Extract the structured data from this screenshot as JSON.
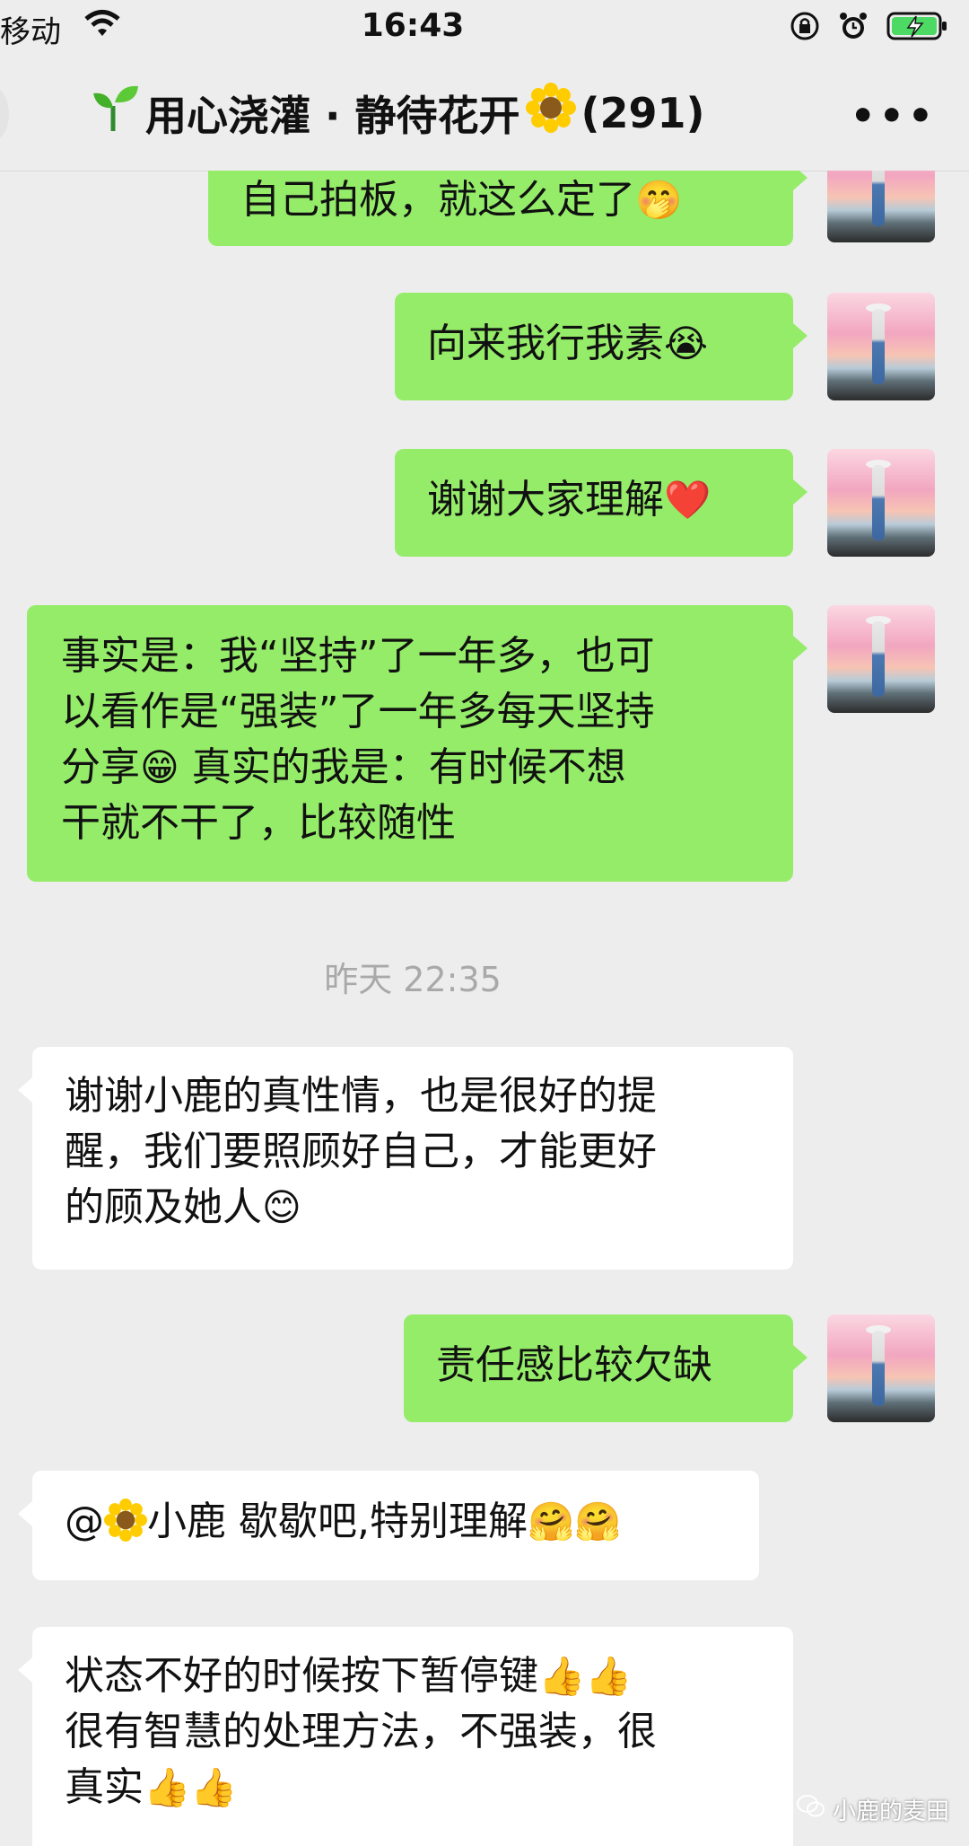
{
  "status": {
    "carrier": "移动",
    "time": "16:43"
  },
  "header": {
    "group_name": "用心浇灌 · 静待花开",
    "member_count": "(291)",
    "title_icons": [
      "seedling-icon",
      "sunflower-icon"
    ]
  },
  "messages": [
    {
      "side": "me",
      "text": "自己拍板，就这么定了",
      "emoji": "🤭"
    },
    {
      "side": "me",
      "text": "向来我行我素",
      "emoji": "😭"
    },
    {
      "side": "me",
      "text": "谢谢大家理解",
      "emoji": "❤️"
    },
    {
      "side": "me",
      "lines": [
        "事实是：我“坚持”了一年多，也可",
        "以看作是“强装”了一年多每天坚持",
        "分享",
        "真实的我是：有时候不想",
        "干就不干了，比较随性"
      ],
      "emoji": "😁"
    },
    {
      "side": "other",
      "lines": [
        "谢谢小鹿的真性情，也是很好的提",
        "醒，我们要照顾好自己，才能更好",
        "的顾及她人"
      ],
      "emoji": "😊"
    },
    {
      "side": "me",
      "text": "责任感比较欠缺"
    },
    {
      "side": "other",
      "prefix": "@",
      "mention": "小鹿",
      "text": "歇歇吧,特别理解",
      "emoji": "🤗"
    },
    {
      "side": "other",
      "lines": [
        "状态不好的时候按下暂停键",
        "很有智慧的处理方法，不强装，很",
        "真实"
      ],
      "emoji": "👍"
    }
  ],
  "timestamp": "昨天 22:35",
  "watermark": "小鹿的麦田"
}
